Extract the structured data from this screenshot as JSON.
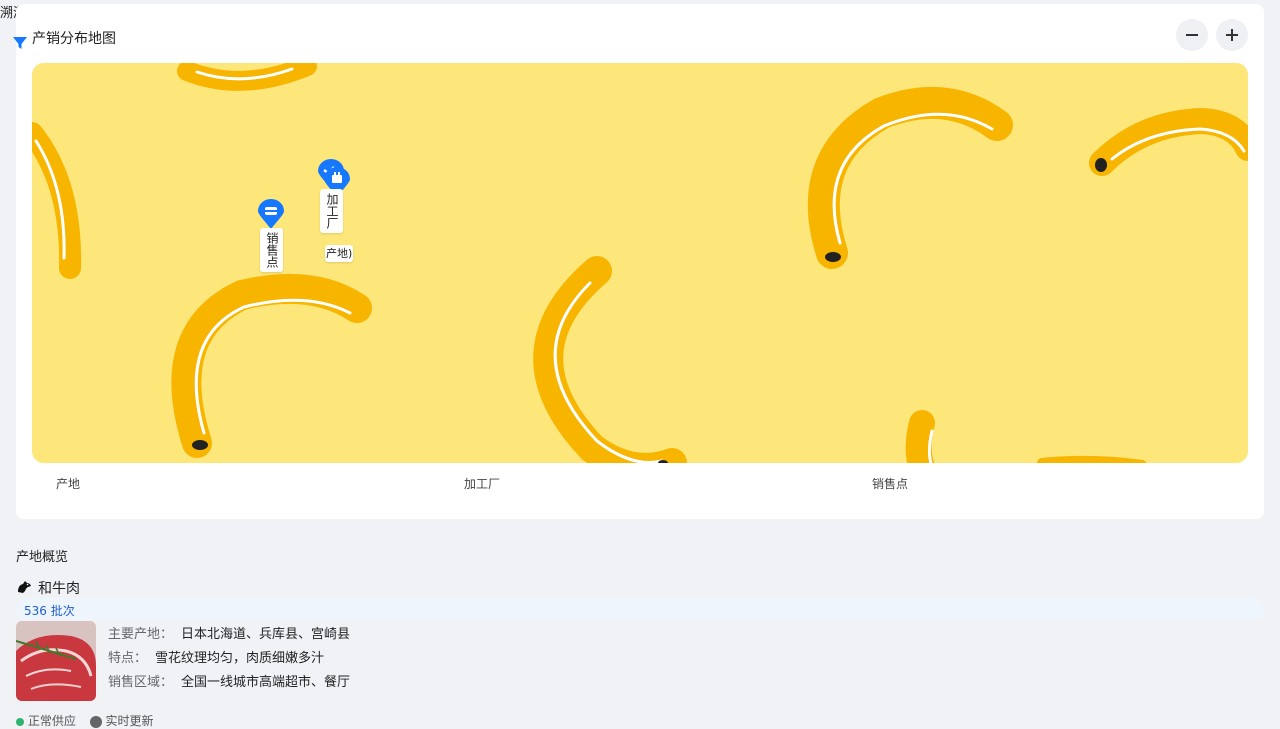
{
  "page": {
    "title": "溯源地图"
  },
  "map_card": {
    "title": "产销分布地图",
    "zoom_out_icon": "minus-icon",
    "zoom_in_icon": "plus-icon",
    "markers": [
      {
        "type": "processing-plant",
        "icon": "factory-icon",
        "label": "加工厂",
        "overlap_label": "产地)"
      },
      {
        "type": "sales-point",
        "icon": "shop-icon",
        "label": "销售点"
      }
    ],
    "legend": [
      "产地",
      "加工厂",
      "销售点"
    ]
  },
  "overview": {
    "section_title": "产地概览",
    "product": {
      "icon": "cow-icon",
      "name": "和牛肉",
      "batches": "536 批次",
      "origin_label": "主要产地：",
      "origin_value": "日本北海道、兵库县、宫崎县",
      "feature_label": "特点：",
      "feature_value": "雪花纹理均匀，肉质细嫩多汁",
      "sales_label": "销售区域：",
      "sales_value": "全国一线城市高端超市、餐厅"
    },
    "status": {
      "supply": "正常供应",
      "update": "实时更新"
    }
  },
  "colors": {
    "accent": "#1677ff",
    "map_bg": "#fde67a",
    "banana": "#f7b500",
    "status_ok": "#2fb36d"
  }
}
